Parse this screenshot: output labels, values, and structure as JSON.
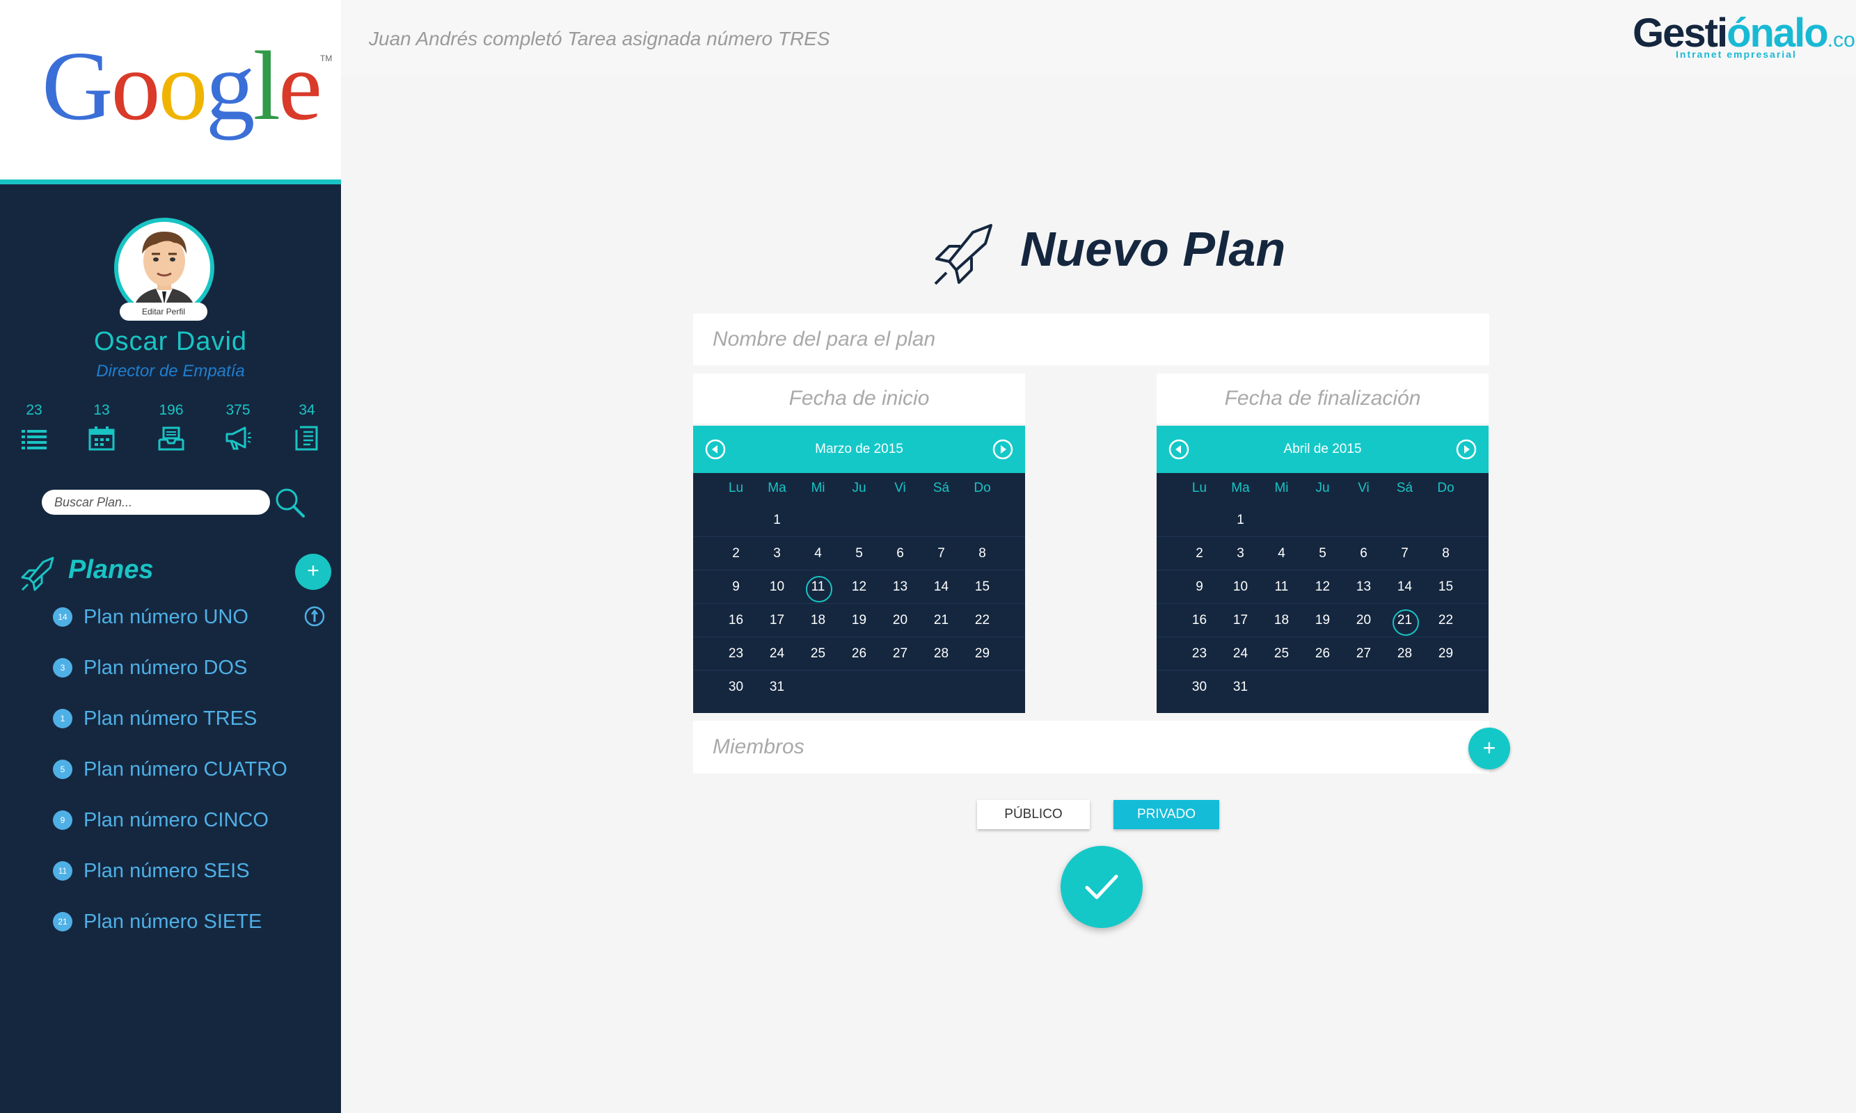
{
  "sidebar": {
    "logo_text": "Google",
    "logo_tm": "TM",
    "profile": {
      "edit_label": "Editar Perfil",
      "name": "Oscar David",
      "role": "Director de Empatía"
    },
    "stats": [
      {
        "value": "23",
        "icon": "list-icon"
      },
      {
        "value": "13",
        "icon": "calendar-icon"
      },
      {
        "value": "196",
        "icon": "inbox-icon"
      },
      {
        "value": "375",
        "icon": "megaphone-icon"
      },
      {
        "value": "34",
        "icon": "document-icon"
      }
    ],
    "search": {
      "placeholder": "Buscar Plan..."
    },
    "plans_title": "Planes",
    "plans_add_label": "+",
    "plans": [
      {
        "badge": "14",
        "label": "Plan número UNO"
      },
      {
        "badge": "3",
        "label": "Plan número DOS"
      },
      {
        "badge": "1",
        "label": "Plan número TRES"
      },
      {
        "badge": "5",
        "label": "Plan número CUATRO"
      },
      {
        "badge": "9",
        "label": "Plan número CINCO"
      },
      {
        "badge": "11",
        "label": "Plan número SEIS"
      },
      {
        "badge": "21",
        "label": "Plan número SIETE"
      }
    ]
  },
  "topbar": {
    "notification": "Juan Andrés completó Tarea asignada número TRES",
    "brand": {
      "pre": "Gesti",
      "accent": "ónalo",
      "suffix": ".co",
      "tagline": "Intranet empresarial"
    }
  },
  "main": {
    "title": "Nuevo Plan",
    "name_placeholder": "Nombre del para el plan",
    "start_label": "Fecha de inicio",
    "end_label": "Fecha de finalización",
    "weekdays": [
      "Lu",
      "Ma",
      "Mi",
      "Ju",
      "Vi",
      "Sá",
      "Do"
    ],
    "start_calendar": {
      "month": "Marzo de 2015",
      "selected": "11"
    },
    "end_calendar": {
      "month": "Abril de 2015",
      "selected": "21"
    },
    "members_placeholder": "Miembros",
    "members_add_label": "+",
    "public_label": "PÚBLICO",
    "private_label": "PRIVADO"
  },
  "colors": {
    "accent": "#19c4c4",
    "sidebar_bg": "#15273f",
    "link_blue": "#4fb0e6",
    "private_button": "#14bcd8"
  }
}
